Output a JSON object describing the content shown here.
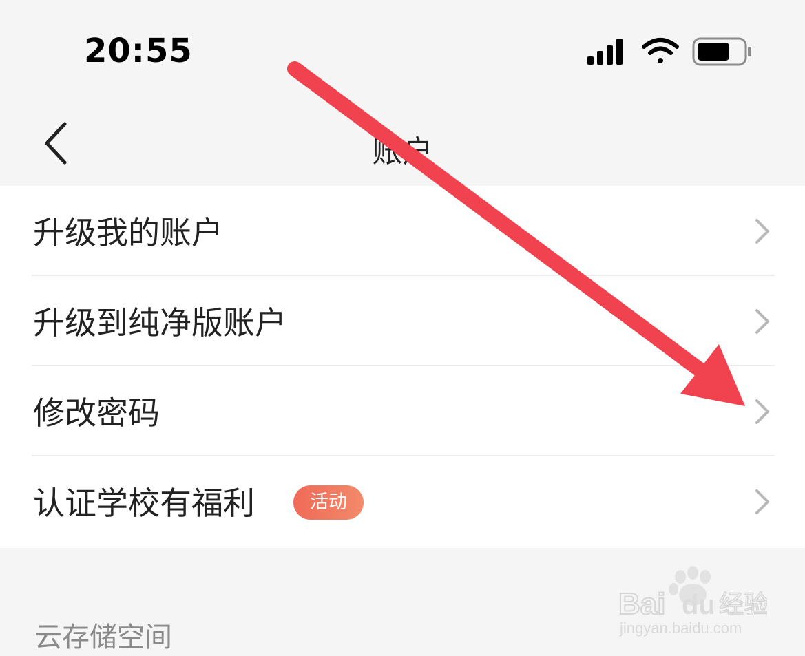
{
  "status_bar": {
    "time": "20:55",
    "icons": [
      "signal-icon",
      "wifi-icon",
      "battery-icon"
    ]
  },
  "nav": {
    "title": "账户",
    "back_icon": "chevron-left-icon"
  },
  "menu": {
    "items": [
      {
        "label": "升级我的账户"
      },
      {
        "label": "升级到纯净版账户"
      },
      {
        "label": "修改密码"
      },
      {
        "label": "认证学校有福利",
        "badge": "活动"
      }
    ]
  },
  "section": {
    "title": "云存储空间"
  },
  "watermark": {
    "brand": "Baidu",
    "product": "经验",
    "url": "jingyan.baidu.com"
  },
  "colors": {
    "background": "#f5f5f5",
    "card": "#ffffff",
    "badge": "#f06a58",
    "annotation_arrow": "#f0434f",
    "chevron": "#b8b8b8"
  }
}
